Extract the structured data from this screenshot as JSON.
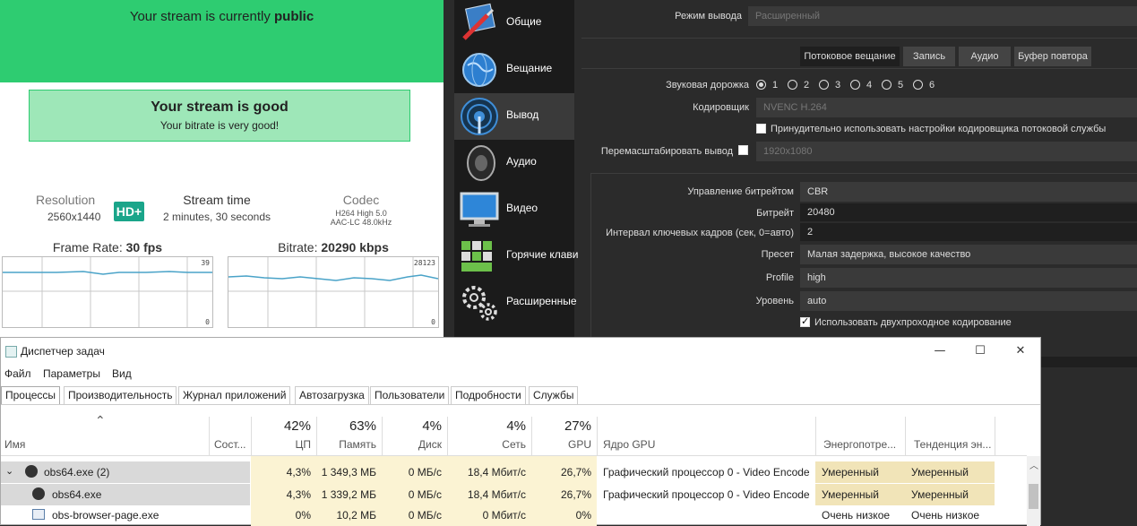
{
  "stream": {
    "status_prefix": "Your stream is currently ",
    "status_value": "public",
    "health_title": "Your stream is good",
    "health_sub": "Your bitrate is very good!",
    "resolution_label": "Resolution",
    "resolution_value": "2560x1440",
    "hd_badge": "HD+",
    "stream_time_label": "Stream time",
    "stream_time_value": "2 minutes, 30 seconds",
    "codec_label": "Codec",
    "codec_video": "H264 High 5.0",
    "codec_audio": "AAC-LC 48.0kHz",
    "framerate_label": "Frame Rate:",
    "framerate_value": "30 fps",
    "framerate_max": "39",
    "framerate_min": "0",
    "bitrate_label": "Bitrate:",
    "bitrate_value": "20290 kbps",
    "bitrate_max": "28123",
    "bitrate_min": "0"
  },
  "obs": {
    "sidebar": [
      {
        "label": "Общие",
        "icon": "general-settings-icon"
      },
      {
        "label": "Вещание",
        "icon": "globe-stream-icon"
      },
      {
        "label": "Вывод",
        "icon": "output-broadcast-icon"
      },
      {
        "label": "Аудио",
        "icon": "speaker-icon"
      },
      {
        "label": "Видео",
        "icon": "monitor-icon"
      },
      {
        "label": "Горячие клави",
        "icon": "keyboard-icon"
      },
      {
        "label": "Расширенные",
        "icon": "gears-icon"
      }
    ],
    "output_mode_label": "Режим вывода",
    "output_mode_value": "Расширенный",
    "tabs": [
      "Потоковое вещание",
      "Запись",
      "Аудио",
      "Буфер повтора"
    ],
    "audio_track_label": "Звуковая дорожка",
    "audio_tracks": [
      "1",
      "2",
      "3",
      "4",
      "5",
      "6"
    ],
    "encoder_label": "Кодировщик",
    "encoder_value": "NVENC H.264",
    "enforce_label": "Принудительно использовать настройки кодировщика потоковой службы",
    "rescale_label": "Перемасштабировать вывод",
    "rescale_value": "1920x1080",
    "rate_control_label": "Управление битрейтом",
    "rate_control_value": "CBR",
    "bitrate_label": "Битрейт",
    "bitrate_value": "20480",
    "keyframe_label": "Интервал ключевых кадров (сек, 0=авто)",
    "keyframe_value": "2",
    "preset_label": "Пресет",
    "preset_value": "Малая задержка, высокое качество",
    "profile_label": "Profile",
    "profile_value": "high",
    "level_label": "Уровень",
    "level_value": "auto",
    "twopass_label": "Использовать двухпроходное кодирование"
  },
  "taskmgr": {
    "title": "Диспетчер задач",
    "menu": [
      "Файл",
      "Параметры",
      "Вид"
    ],
    "tabs": [
      "Процессы",
      "Производительность",
      "Журнал приложений",
      "Автозагрузка",
      "Пользователи",
      "Подробности",
      "Службы"
    ],
    "cols": {
      "name": "Имя",
      "status": "Сост...",
      "cpu": "ЦП",
      "cpu_pct": "42%",
      "mem": "Память",
      "mem_pct": "63%",
      "disk": "Диск",
      "disk_pct": "4%",
      "net": "Сеть",
      "net_pct": "4%",
      "gpu": "GPU",
      "gpu_pct": "27%",
      "gpu_engine": "Ядро GPU",
      "power": "Энергопотре...",
      "power_trend": "Тенденция эн..."
    },
    "rows": [
      {
        "name": "obs64.exe (2)",
        "cpu": "4,3%",
        "mem": "1 349,3 МБ",
        "disk": "0 МБ/с",
        "net": "18,4 Мбит/с",
        "gpu": "26,7%",
        "engine": "Графический процессор 0 - Video Encode",
        "power": "Умеренный",
        "trend": "Умеренный"
      },
      {
        "name": "obs64.exe",
        "cpu": "4,3%",
        "mem": "1 339,2 МБ",
        "disk": "0 МБ/с",
        "net": "18,4 Мбит/с",
        "gpu": "26,7%",
        "engine": "Графический процессор 0 - Video Encode",
        "power": "Умеренный",
        "trend": "Умеренный"
      },
      {
        "name": "obs-browser-page.exe",
        "cpu": "0%",
        "mem": "10,2 МБ",
        "disk": "0 МБ/с",
        "net": "0 Мбит/с",
        "gpu": "0%",
        "engine": "",
        "power": "Очень низкое",
        "trend": "Очень низкое"
      }
    ]
  }
}
